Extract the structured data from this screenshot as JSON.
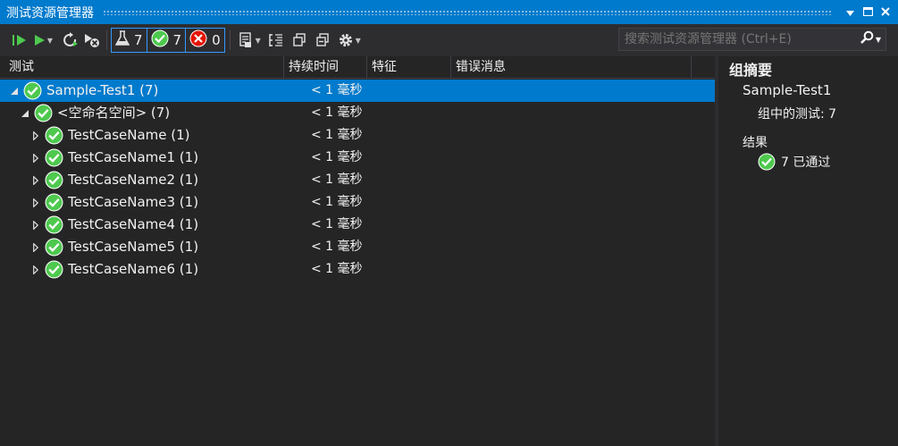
{
  "window": {
    "title": "测试资源管理器",
    "pin_icon": "pin-icon",
    "maximize_icon": "maximize-icon",
    "close_icon": "close-icon"
  },
  "toolbar": {
    "counters": [
      {
        "icon": "flask-icon",
        "value": "7"
      },
      {
        "icon": "pass-icon",
        "value": "7"
      },
      {
        "icon": "fail-icon",
        "value": "0"
      }
    ],
    "search_placeholder": "搜索测试资源管理器 (Ctrl+E)"
  },
  "grid": {
    "columns": [
      "测试",
      "持续时间",
      "特征",
      "错误消息"
    ],
    "rows": [
      {
        "name": "Sample-Test1 (7)",
        "duration": "< 1 毫秒",
        "expanded": true,
        "level": 0
      },
      {
        "name": "<空命名空间> (7)",
        "duration": "< 1 毫秒",
        "expanded": true,
        "level": 1
      },
      {
        "name": "TestCaseName (1)",
        "duration": "< 1 毫秒",
        "expanded": false,
        "level": 2
      },
      {
        "name": "TestCaseName1 (1)",
        "duration": "< 1 毫秒",
        "expanded": false,
        "level": 2
      },
      {
        "name": "TestCaseName2 (1)",
        "duration": "< 1 毫秒",
        "expanded": false,
        "level": 2
      },
      {
        "name": "TestCaseName3 (1)",
        "duration": "< 1 毫秒",
        "expanded": false,
        "level": 2
      },
      {
        "name": "TestCaseName4 (1)",
        "duration": "< 1 毫秒",
        "expanded": false,
        "level": 2
      },
      {
        "name": "TestCaseName5 (1)",
        "duration": "< 1 毫秒",
        "expanded": false,
        "level": 2
      },
      {
        "name": "TestCaseName6 (1)",
        "duration": "< 1 毫秒",
        "expanded": false,
        "level": 2
      }
    ]
  },
  "summary": {
    "title": "组摘要",
    "group_name": "Sample-Test1",
    "tests_in_group": "组中的测试: 7",
    "result_label": "结果",
    "passed_text": "7 已通过"
  },
  "colors": {
    "accent": "#007acc",
    "background": "#252526",
    "toolbar": "#2d2d30",
    "pass_green": "#4ec94e",
    "fail_red": "#e51400"
  }
}
